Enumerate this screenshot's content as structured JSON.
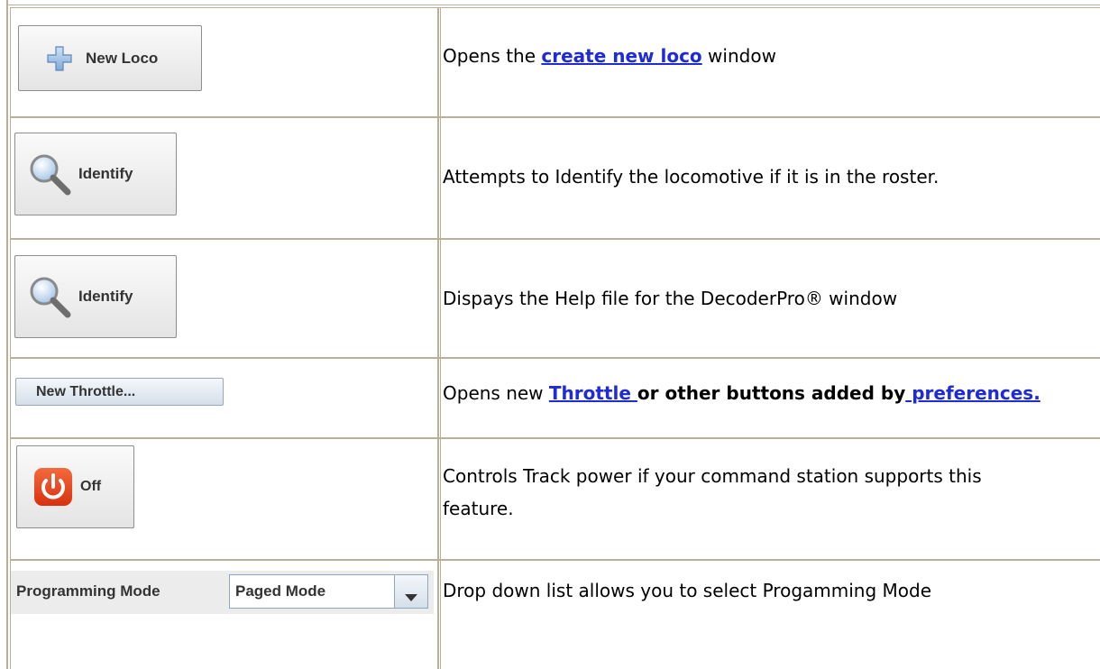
{
  "rows": [
    {
      "button": {
        "label": "New Loco",
        "icon": "plus-icon"
      },
      "description": {
        "before": "Opens the ",
        "link": "create new loco",
        "after": " window"
      }
    },
    {
      "button": {
        "label": "Identify",
        "icon": "magnifier-icon"
      },
      "description": {
        "text": "Attempts to Identify the locomotive if it is in the roster."
      }
    },
    {
      "button": {
        "label": "Identify",
        "icon": "magnifier-icon"
      },
      "description": {
        "text": "Dispays the Help file for the DecoderPro® window"
      }
    },
    {
      "button": {
        "label": "New Throttle..."
      },
      "description": {
        "before": "Opens new ",
        "link1": "Throttle ",
        "bold": "or other buttons added by",
        "link2": " preferences."
      }
    },
    {
      "button": {
        "label": "Off",
        "icon": "power-icon"
      },
      "description": {
        "line1": "Controls Track power if your command station supports this",
        "line2": "feature."
      }
    },
    {
      "control": {
        "label": "Programming Mode",
        "selected": "Paged Mode",
        "icon": "dropdown-arrow-icon"
      },
      "description": {
        "text": "Drop down list allows you to select Progamming Mode"
      }
    }
  ],
  "colors": {
    "link": "#1f2bd4",
    "power": "#e8401c",
    "border": "#b9b09a"
  }
}
